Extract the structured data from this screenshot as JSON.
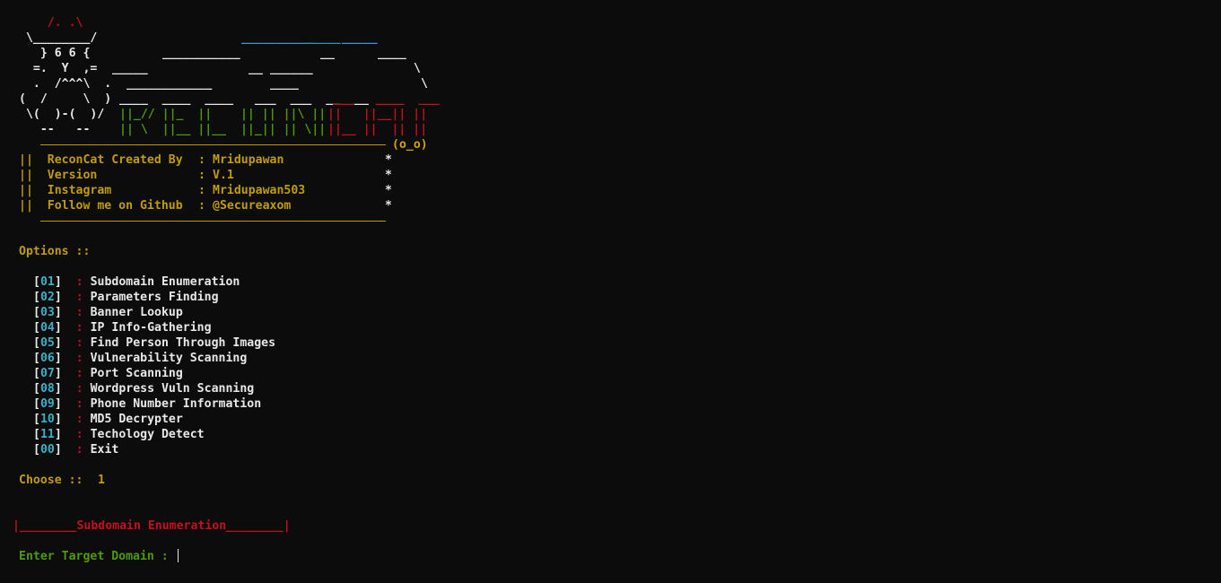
{
  "banner": {
    "ascii_lines": [
      {
        "segments": [
          {
            "t": "    /. .\\",
            "c": "red"
          }
        ]
      },
      {
        "segments": [
          {
            "t": " \\________/",
            "c": "white"
          }
        ]
      },
      {
        "segments": [
          {
            "t": "   } 6 6 {",
            "c": "white"
          },
          {
            "t": "         _____      ",
            "c": "white"
          },
          {
            "t": "                     _____",
            "c": "cyan"
          }
        ]
      },
      {
        "segments": [
          {
            "t": "  =.  Y  ,=  ",
            "c": "white"
          }
        ]
      },
      {
        "segments": [
          {
            "t": "  .  /^^^\\  .",
            "c": "white"
          }
        ]
      },
      {
        "segments": [
          {
            "t": "(  /     \\  )",
            "c": "white"
          }
        ]
      },
      {
        "segments": [
          {
            "t": " \\(  )-(  )/ ",
            "c": "white"
          },
          {
            "t": " ||_// ||_  ||    || || ||\\ || ",
            "c": "green"
          },
          {
            "t": "||   ||__|| ||",
            "c": "red"
          }
        ]
      },
      {
        "segments": [
          {
            "t": "   --   --   ",
            "c": "white"
          },
          {
            "t": " || \\  ||__ ||__  ||_|| || \\|| ",
            "c": "green"
          },
          {
            "t": "||__ ||  || ||",
            "c": "red"
          }
        ]
      }
    ],
    "face": "(o_o)"
  },
  "info": [
    {
      "key": "ReconCat Created By",
      "value": "Mridupawan"
    },
    {
      "key": "Version",
      "value": "V.1"
    },
    {
      "key": "Instagram",
      "value": "Mridupawan503"
    },
    {
      "key": "Follow me on Github",
      "value": "@Secureaxom"
    }
  ],
  "info_separator": ":",
  "info_border": "||",
  "info_star": "*",
  "options_title": "Options ::",
  "options": [
    {
      "num": "01",
      "label": "Subdomain Enumeration"
    },
    {
      "num": "02",
      "label": "Parameters Finding"
    },
    {
      "num": "03",
      "label": "Banner Lookup"
    },
    {
      "num": "04",
      "label": "IP Info-Gathering"
    },
    {
      "num": "05",
      "label": "Find Person Through Images"
    },
    {
      "num": "06",
      "label": "Vulnerability Scanning"
    },
    {
      "num": "07",
      "label": "Port Scanning"
    },
    {
      "num": "08",
      "label": "Wordpress Vuln Scanning"
    },
    {
      "num": "09",
      "label": "Phone Number Information"
    },
    {
      "num": "10",
      "label": "MD5 Decrypter"
    },
    {
      "num": "11",
      "label": "Techology Detect"
    },
    {
      "num": "00",
      "label": "Exit"
    }
  ],
  "choose_label": "Choose ::",
  "choose_value": "1",
  "section_banner": "|________Subdomain Enumeration________|",
  "prompt_label": "Enter Target Domain :",
  "prompt_value": ""
}
